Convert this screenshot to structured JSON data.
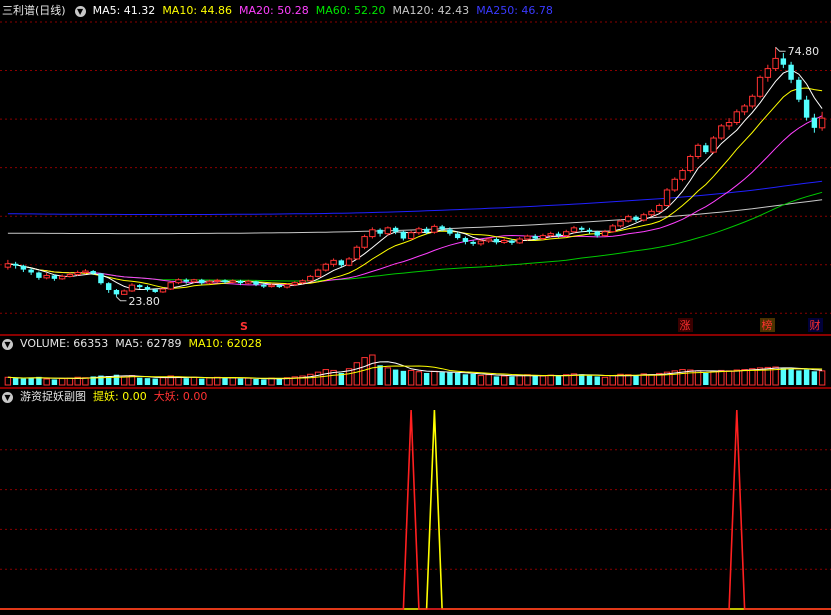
{
  "main_header": {
    "title": "三利谱(日线)",
    "ma5": "MA5: 41.32",
    "ma10": "MA10: 44.86",
    "ma20": "MA20: 50.28",
    "ma60": "MA60: 52.20",
    "ma120": "MA120: 42.43",
    "ma250": "MA250: 46.78"
  },
  "volume_header": {
    "volume": "VOLUME: 66353",
    "ma5": "MA5: 62789",
    "ma10": "MA10: 62028"
  },
  "indicator_header": {
    "title": "游资捉妖副图",
    "tiyao": "提妖: 0.00",
    "dayao": "大妖: 0.00"
  },
  "markers": {
    "s": "S",
    "zhang": "涨",
    "bang": "榜",
    "cai": "财"
  },
  "colors": {
    "up": "#ff3232",
    "down": "#54ffff",
    "ma5": "#ffffff",
    "ma10": "#ffff00",
    "ma20": "#ff40ff",
    "ma60": "#00c800",
    "ma120": "#c8c8c8",
    "ma250": "#2020ff",
    "grid": "#8a0000"
  },
  "chart_data": {
    "type": "candlestick",
    "price_high_label": "74.80",
    "price_low_label": "23.80",
    "price_high": 74.8,
    "price_low": 23.8,
    "candles": [
      [
        29.5,
        30.2,
        31.0,
        29.0
      ],
      [
        30.2,
        29.8,
        30.6,
        29.2
      ],
      [
        29.8,
        29.0,
        30.0,
        28.5
      ],
      [
        29.0,
        28.4,
        29.3,
        27.9
      ],
      [
        28.4,
        27.3,
        28.6,
        26.9
      ],
      [
        27.3,
        27.8,
        28.3,
        27.0
      ],
      [
        27.8,
        27.1,
        28.0,
        26.7
      ],
      [
        27.1,
        27.6,
        28.0,
        26.9
      ],
      [
        27.6,
        28.0,
        28.4,
        27.4
      ],
      [
        28.0,
        28.4,
        28.8,
        27.7
      ],
      [
        28.4,
        28.7,
        29.1,
        28.1
      ],
      [
        28.7,
        28.2,
        28.9,
        27.9
      ],
      [
        28.2,
        26.2,
        28.3,
        25.9
      ],
      [
        26.2,
        24.8,
        26.4,
        24.2
      ],
      [
        24.8,
        23.9,
        25.0,
        23.4
      ],
      [
        23.9,
        24.6,
        24.9,
        23.8
      ],
      [
        24.6,
        25.8,
        26.2,
        24.4
      ],
      [
        25.8,
        25.4,
        26.0,
        25.0
      ],
      [
        25.4,
        24.9,
        25.7,
        24.5
      ],
      [
        24.9,
        24.4,
        25.0,
        24.2
      ],
      [
        24.4,
        25.0,
        25.2,
        24.2
      ],
      [
        25.0,
        26.3,
        26.6,
        24.8
      ],
      [
        26.3,
        26.9,
        27.2,
        26.0
      ],
      [
        26.9,
        26.5,
        27.2,
        26.1
      ],
      [
        26.5,
        26.9,
        27.1,
        26.2
      ],
      [
        26.9,
        26.2,
        27.1,
        25.9
      ],
      [
        26.2,
        26.6,
        26.9,
        26.0
      ],
      [
        26.6,
        26.8,
        27.1,
        26.3
      ],
      [
        26.8,
        26.4,
        27.0,
        26.1
      ],
      [
        26.4,
        26.7,
        27.0,
        26.2
      ],
      [
        26.7,
        26.2,
        26.9,
        25.8
      ],
      [
        26.2,
        26.6,
        26.9,
        26.0
      ],
      [
        26.6,
        25.9,
        26.7,
        25.6
      ],
      [
        25.9,
        25.5,
        26.2,
        25.2
      ],
      [
        25.5,
        25.8,
        26.1,
        25.3
      ],
      [
        25.8,
        25.4,
        26.0,
        25.2
      ],
      [
        25.4,
        25.9,
        26.2,
        25.1
      ],
      [
        25.9,
        26.3,
        26.6,
        25.6
      ],
      [
        26.3,
        26.7,
        27.0,
        26.0
      ],
      [
        26.7,
        27.6,
        27.9,
        26.5
      ],
      [
        27.6,
        28.9,
        29.2,
        27.4
      ],
      [
        28.9,
        30.1,
        30.4,
        28.6
      ],
      [
        30.1,
        30.9,
        31.3,
        29.6
      ],
      [
        30.9,
        29.9,
        31.1,
        29.5
      ],
      [
        29.9,
        31.2,
        31.6,
        29.7
      ],
      [
        31.2,
        33.6,
        34.0,
        31.0
      ],
      [
        33.6,
        35.8,
        36.2,
        33.2
      ],
      [
        35.8,
        37.2,
        37.7,
        35.4
      ],
      [
        37.2,
        36.4,
        37.5,
        35.8
      ],
      [
        36.4,
        37.6,
        37.9,
        36.0
      ],
      [
        37.6,
        36.8,
        37.9,
        36.3
      ],
      [
        36.8,
        35.4,
        37.0,
        35.0
      ],
      [
        35.4,
        36.6,
        37.0,
        35.1
      ],
      [
        36.6,
        37.4,
        37.8,
        36.2
      ],
      [
        37.4,
        36.7,
        37.8,
        36.3
      ],
      [
        36.7,
        37.9,
        38.3,
        36.4
      ],
      [
        37.9,
        37.3,
        38.2,
        36.9
      ],
      [
        37.3,
        36.4,
        37.7,
        36.0
      ],
      [
        36.4,
        35.5,
        36.7,
        35.2
      ],
      [
        35.5,
        34.7,
        35.8,
        34.2
      ],
      [
        34.7,
        34.3,
        35.0,
        33.9
      ],
      [
        34.3,
        34.9,
        35.2,
        33.9
      ],
      [
        34.9,
        35.3,
        35.5,
        34.5
      ],
      [
        35.3,
        34.6,
        35.6,
        34.2
      ],
      [
        34.6,
        35.0,
        35.4,
        34.3
      ],
      [
        35.0,
        34.5,
        35.3,
        34.1
      ],
      [
        34.5,
        35.3,
        35.7,
        34.3
      ],
      [
        35.3,
        35.9,
        36.2,
        35.0
      ],
      [
        35.9,
        35.4,
        36.3,
        35.0
      ],
      [
        35.4,
        36.0,
        36.4,
        35.1
      ],
      [
        36.0,
        36.4,
        36.8,
        35.7
      ],
      [
        36.4,
        36.0,
        36.8,
        35.6
      ],
      [
        36.0,
        36.8,
        37.2,
        35.7
      ],
      [
        36.8,
        37.6,
        38.0,
        36.5
      ],
      [
        37.6,
        37.2,
        37.9,
        36.8
      ],
      [
        37.2,
        36.8,
        37.6,
        36.4
      ],
      [
        36.8,
        36.0,
        37.0,
        35.6
      ],
      [
        36.0,
        36.8,
        37.2,
        35.8
      ],
      [
        36.8,
        38.0,
        38.4,
        36.6
      ],
      [
        38.0,
        39.0,
        39.4,
        37.7
      ],
      [
        39.0,
        39.9,
        40.3,
        38.7
      ],
      [
        39.9,
        39.2,
        40.2,
        38.8
      ],
      [
        39.2,
        40.3,
        40.7,
        38.9
      ],
      [
        40.3,
        41.0,
        41.4,
        40.0
      ],
      [
        41.0,
        42.2,
        42.6,
        40.7
      ],
      [
        42.2,
        45.4,
        45.8,
        42.0
      ],
      [
        45.4,
        47.6,
        48.0,
        45.0
      ],
      [
        47.6,
        49.4,
        49.8,
        47.2
      ],
      [
        49.4,
        52.3,
        52.7,
        49.0
      ],
      [
        52.3,
        54.6,
        55.0,
        51.8
      ],
      [
        54.6,
        53.2,
        55.1,
        52.8
      ],
      [
        53.2,
        56.1,
        56.5,
        52.9
      ],
      [
        56.1,
        58.6,
        59.0,
        55.7
      ],
      [
        58.6,
        59.3,
        60.2,
        57.8
      ],
      [
        59.3,
        61.5,
        62.0,
        58.8
      ],
      [
        61.5,
        62.7,
        63.1,
        60.8
      ],
      [
        62.7,
        64.7,
        65.1,
        62.2
      ],
      [
        64.7,
        68.6,
        69.0,
        64.3
      ],
      [
        68.6,
        70.4,
        71.2,
        67.7
      ],
      [
        70.4,
        72.5,
        74.8,
        69.9
      ],
      [
        72.5,
        71.2,
        73.6,
        70.5
      ],
      [
        71.2,
        68.1,
        71.8,
        67.4
      ],
      [
        68.1,
        64.0,
        68.7,
        63.5
      ],
      [
        64.0,
        60.3,
        64.8,
        59.7
      ],
      [
        60.3,
        58.2,
        61.1,
        57.2
      ],
      [
        58.2,
        60.2,
        61.5,
        57.6
      ]
    ],
    "ma_last": {
      "ma5": 41.32,
      "ma10": 44.86,
      "ma20": 50.28,
      "ma60": 52.2,
      "ma120": 42.43,
      "ma250": 46.78
    },
    "volume": [
      18000,
      16000,
      15000,
      17000,
      19000,
      14000,
      13000,
      15000,
      16000,
      18000,
      17000,
      20000,
      22000,
      21000,
      24000,
      19000,
      22000,
      17000,
      16000,
      15000,
      17000,
      21000,
      19000,
      16000,
      18000,
      15000,
      17000,
      18000,
      16000,
      17000,
      15000,
      16000,
      14000,
      13000,
      16000,
      15000,
      17000,
      19000,
      21000,
      25000,
      30000,
      36000,
      34000,
      28000,
      38000,
      52000,
      64000,
      70000,
      46000,
      40000,
      36000,
      33000,
      34000,
      31000,
      28000,
      32000,
      30000,
      29000,
      28000,
      25000,
      26000,
      22000,
      24000,
      20000,
      21000,
      20000,
      22000,
      24000,
      22000,
      21000,
      23000,
      21000,
      24000,
      26000,
      25000,
      22000,
      20000,
      18000,
      22000,
      25000,
      24000,
      22000,
      26000,
      24000,
      27000,
      30000,
      33000,
      36000,
      35000,
      33000,
      28000,
      32000,
      34000,
      33000,
      35000,
      36000,
      38000,
      40000,
      41000,
      42000,
      39000,
      38000,
      34000,
      36000,
      32000,
      33000
    ],
    "indicator": {
      "tiyao_spikes": [
        55
      ],
      "dayao_spikes": [
        52,
        94
      ]
    }
  }
}
